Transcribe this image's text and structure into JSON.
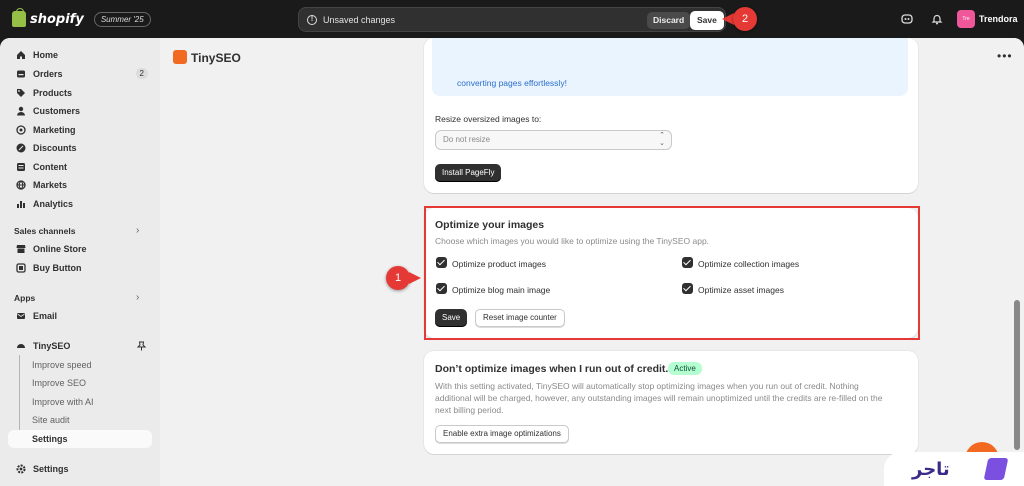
{
  "topbar": {
    "logo_text": "shopify",
    "edition": "Summer '25",
    "unsaved_text": "Unsaved changes",
    "discard_label": "Discard",
    "save_label": "Save",
    "store_avatar": "Tre",
    "store_name": "Trendora"
  },
  "markers": {
    "step1": "1",
    "step2": "2"
  },
  "sidebar": {
    "items": [
      {
        "label": "Home",
        "icon": "home-icon"
      },
      {
        "label": "Orders",
        "icon": "orders-icon",
        "count": "2"
      },
      {
        "label": "Products",
        "icon": "tag-icon"
      },
      {
        "label": "Customers",
        "icon": "person-icon"
      },
      {
        "label": "Marketing",
        "icon": "target-icon"
      },
      {
        "label": "Discounts",
        "icon": "discount-icon"
      },
      {
        "label": "Content",
        "icon": "content-icon"
      },
      {
        "label": "Markets",
        "icon": "globe-icon"
      },
      {
        "label": "Analytics",
        "icon": "chart-icon"
      }
    ],
    "sales_channels_label": "Sales channels",
    "sales_channels": [
      {
        "label": "Online Store",
        "icon": "store-icon"
      },
      {
        "label": "Buy Button",
        "icon": "button-icon"
      }
    ],
    "apps_label": "Apps",
    "apps": [
      {
        "label": "Email",
        "icon": "email-icon"
      }
    ],
    "tinyseo": {
      "label": "TinySEO",
      "sub": [
        "Improve speed",
        "Improve SEO",
        "Improve with AI",
        "Site audit",
        "Settings"
      ]
    },
    "settings_label": "Settings"
  },
  "app": {
    "title": "TinySEO",
    "menu": "•••"
  },
  "banner": {
    "text": "converting pages effortlessly!"
  },
  "resize_card": {
    "label": "Resize oversized images to:",
    "select_value": "Do not resize",
    "button": "Install PageFly"
  },
  "optimize_card": {
    "title": "Optimize your images",
    "description": "Choose which images you would like to optimize using the TinySEO app.",
    "options": [
      {
        "label": "Optimize product images",
        "checked": true
      },
      {
        "label": "Optimize collection images",
        "checked": true
      },
      {
        "label": "Optimize blog main image",
        "checked": true
      },
      {
        "label": "Optimize asset images",
        "checked": true
      }
    ],
    "save_label": "Save",
    "reset_label": "Reset image counter"
  },
  "credit_card": {
    "title": "Don’t optimize images when I run out of credit.",
    "badge": "Active",
    "description_line1": "With this setting activated, TinySEO will automatically stop optimizing images when you run out of credit. Nothing",
    "description_line2": "additional will be charged, however, any outstanding images will remain unoptimized until the credits are re-filled on the",
    "description_line3": "next billing period.",
    "button": "Enable extra image optimizations"
  },
  "brand": {
    "text": "تاجر"
  },
  "colors": {
    "accent_red": "#e53935",
    "active_badge": "#b4fed2",
    "banner_bg": "#eaf4ff",
    "app_orange": "#f26a21"
  }
}
